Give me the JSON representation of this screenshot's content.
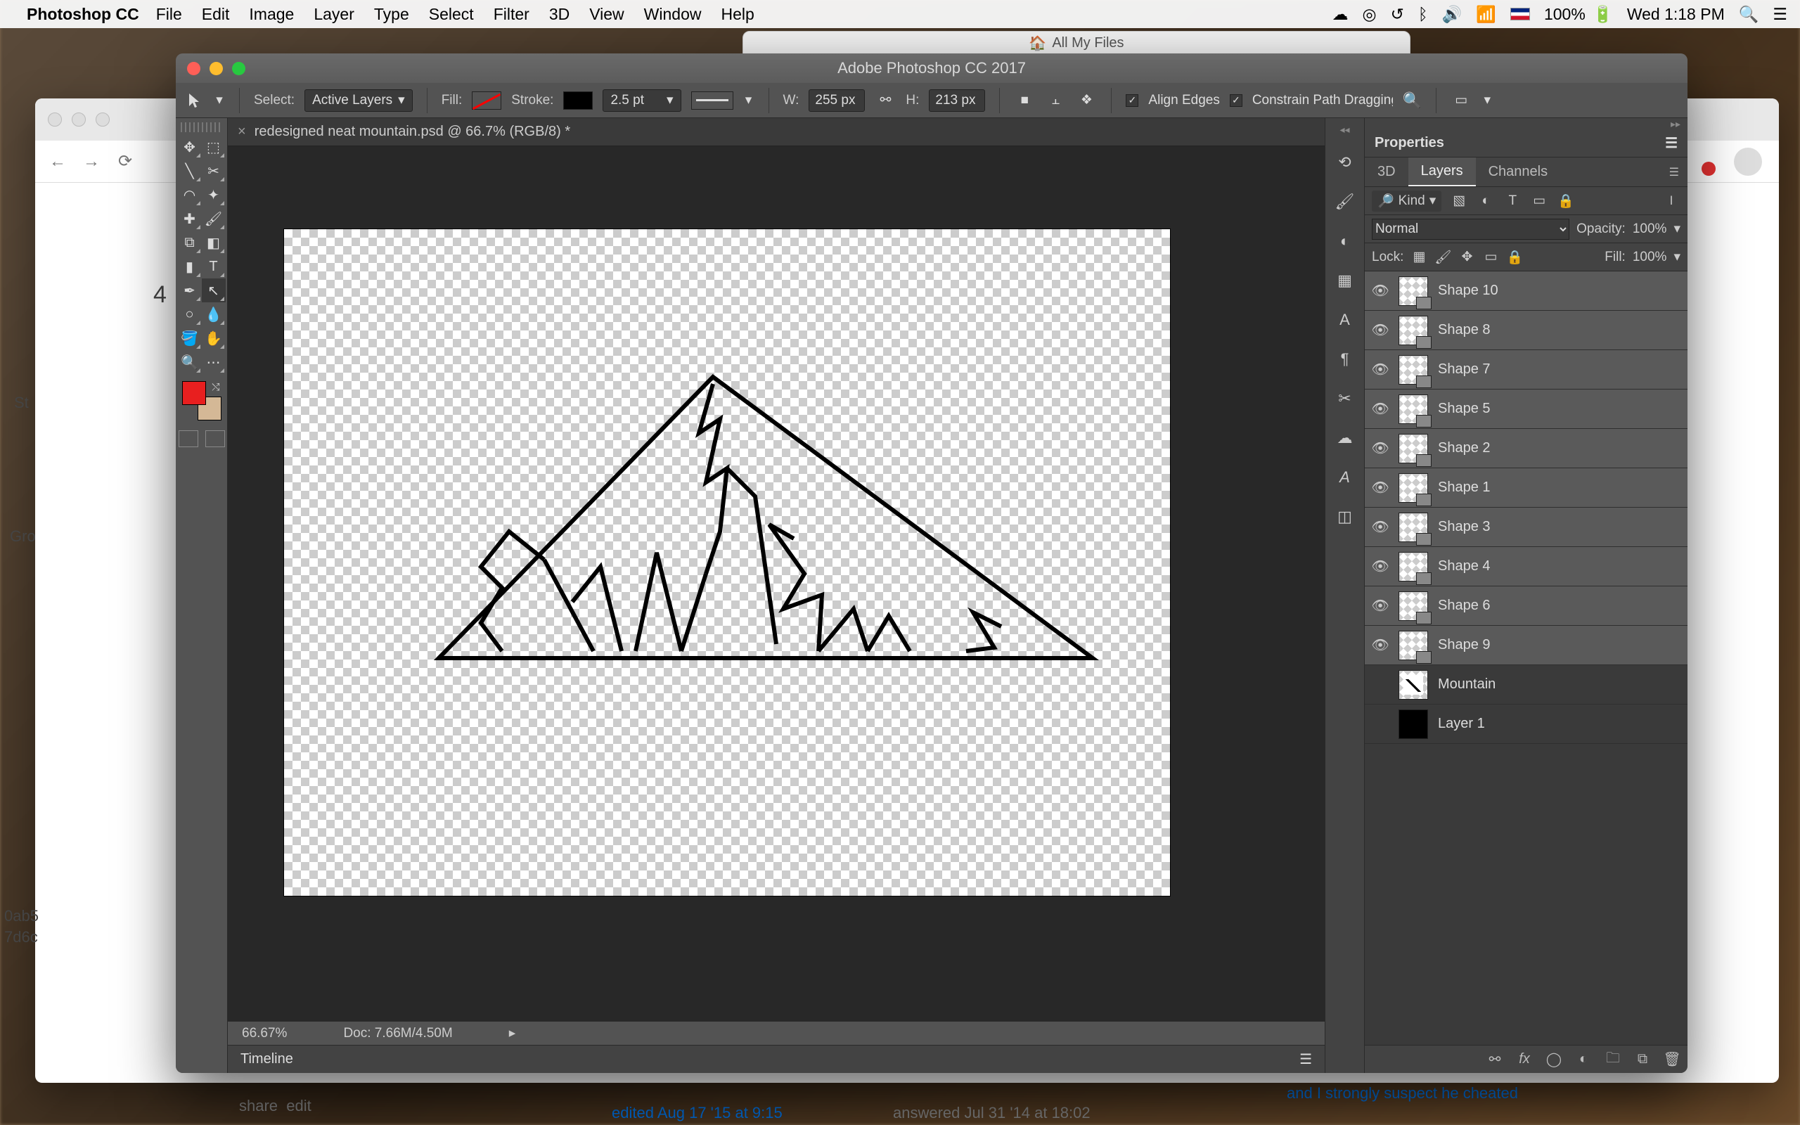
{
  "menubar": {
    "app": "Photoshop CC",
    "items": [
      "File",
      "Edit",
      "Image",
      "Layer",
      "Type",
      "Select",
      "Filter",
      "3D",
      "View",
      "Window",
      "Help"
    ],
    "battery": "100%",
    "clock": "Wed 1:18 PM"
  },
  "finder_peek": "All My Files",
  "ps": {
    "title": "Adobe Photoshop CC 2017",
    "doc_tab": "redesigned neat mountain.psd @ 66.7% (RGB/8) *",
    "options": {
      "select_label": "Select:",
      "select_value": "Active Layers",
      "fill_label": "Fill:",
      "stroke_label": "Stroke:",
      "stroke_pt": "2.5 pt",
      "w_label": "W:",
      "w_value": "255 px",
      "h_label": "H:",
      "h_value": "213 px",
      "align_edges": "Align Edges",
      "constrain": "Constrain Path Dragging"
    },
    "status": {
      "zoom": "66.67%",
      "doc": "Doc: 7.66M/4.50M"
    },
    "timeline": "Timeline"
  },
  "panels": {
    "properties": "Properties",
    "tabs": {
      "threeD": "3D",
      "layers": "Layers",
      "channels": "Channels"
    },
    "filter": {
      "kind": "Kind"
    },
    "blend": {
      "mode": "Normal",
      "opacity_label": "Opacity:",
      "opacity": "100%"
    },
    "lock": {
      "label": "Lock:",
      "fill_label": "Fill:",
      "fill": "100%"
    },
    "layers": [
      {
        "name": "Shape 10",
        "vis": true,
        "sel": true,
        "type": "shape"
      },
      {
        "name": "Shape 8",
        "vis": true,
        "sel": true,
        "type": "shape"
      },
      {
        "name": "Shape 7",
        "vis": true,
        "sel": true,
        "type": "shape"
      },
      {
        "name": "Shape 5",
        "vis": true,
        "sel": true,
        "type": "shape"
      },
      {
        "name": "Shape 2",
        "vis": true,
        "sel": true,
        "type": "shape"
      },
      {
        "name": "Shape 1",
        "vis": true,
        "sel": true,
        "type": "shape"
      },
      {
        "name": "Shape 3",
        "vis": true,
        "sel": true,
        "type": "shape"
      },
      {
        "name": "Shape 4",
        "vis": true,
        "sel": true,
        "type": "shape"
      },
      {
        "name": "Shape 6",
        "vis": true,
        "sel": true,
        "type": "shape"
      },
      {
        "name": "Shape 9",
        "vis": true,
        "sel": true,
        "type": "shape"
      },
      {
        "name": "Mountain",
        "vis": false,
        "sel": false,
        "type": "mtn"
      },
      {
        "name": "Layer 1",
        "vis": false,
        "sel": false,
        "type": "black"
      }
    ]
  },
  "behind": {
    "vote": "4",
    "share": "share",
    "edit": "edit",
    "edited": "edited Aug 17 '15 at 9:15",
    "answered": "answered Jul 31 '14 at 18:02",
    "cheated": "and I strongly suspect he cheated",
    "left_snips": [
      "St",
      "Gro",
      "0ab5",
      "7d6c"
    ]
  }
}
